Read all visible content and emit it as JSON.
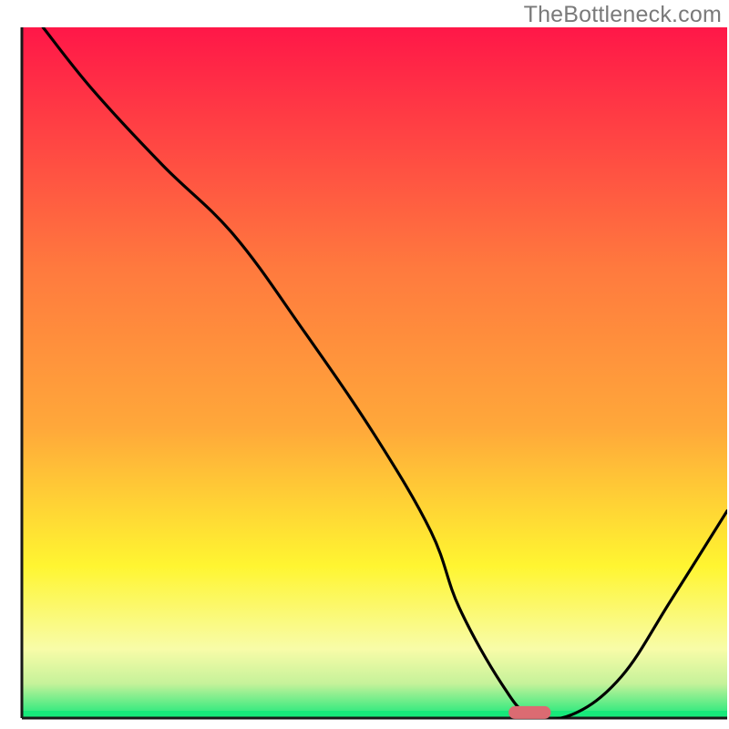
{
  "watermark": "TheBottleneck.com",
  "chart_data": {
    "type": "line",
    "title": "",
    "xlabel": "",
    "ylabel": "",
    "xlim": [
      0,
      100
    ],
    "ylim": [
      0,
      100
    ],
    "grid": false,
    "legend": false,
    "x": [
      3,
      10,
      20,
      30,
      40,
      50,
      58,
      62,
      68,
      72,
      78,
      85,
      92,
      100
    ],
    "values": [
      100,
      91,
      80,
      70,
      56,
      41,
      27,
      16,
      5,
      0.5,
      0.5,
      6,
      17,
      30
    ],
    "marker": {
      "x_start": 69,
      "x_end": 75,
      "y": 0.8
    },
    "colors": {
      "curve": "#000000",
      "marker": "#db6b72",
      "axis": "#181818",
      "top": "#ff1748",
      "mid": "#ffa83a",
      "yellow": "#fff531",
      "pale": "#f8fca8",
      "green_band_top": "#c6f29a",
      "green": "#17e87a"
    }
  }
}
